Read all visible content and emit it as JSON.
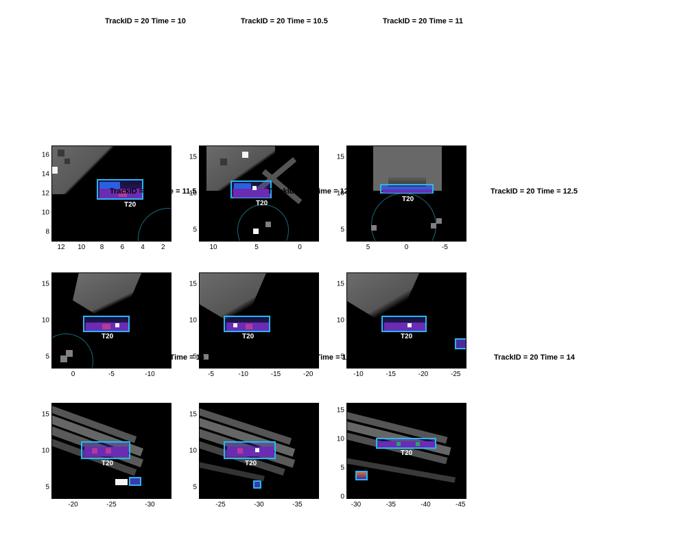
{
  "titles": {
    "r1c1": "TrackID = 20 Time = 10",
    "r1c2": "TrackID = 20 Time = 10.5",
    "r1c3": "TrackID = 20 Time = 11",
    "r2c1": "TrackID = 20 Time = 11.5",
    "r2c2": "TrackID = 20 Time = 12",
    "r2c3": "TrackID = 20 Time = 12.5",
    "r3c1": "TrackID = 20 Time = 13",
    "r3c2": "TrackID = 20 Time = 13.5",
    "r3c3": "TrackID = 20 Time = 14"
  },
  "track_label": "T20",
  "axes": {
    "r1c1": {
      "x": [
        "12",
        "10",
        "8",
        "6",
        "4",
        "2"
      ],
      "y": [
        "8",
        "10",
        "12",
        "14",
        "16"
      ]
    },
    "r1c2": {
      "x": [
        "10",
        "5",
        "0"
      ],
      "y": [
        "5",
        "10",
        "15"
      ]
    },
    "r1c3": {
      "x": [
        "5",
        "0",
        "-5"
      ],
      "y": [
        "5",
        "10",
        "15"
      ]
    },
    "r2c1": {
      "x": [
        "0",
        "-5",
        "-10"
      ],
      "y": [
        "5",
        "10",
        "15"
      ]
    },
    "r2c2": {
      "x": [
        "-5",
        "-10",
        "-15",
        "-20"
      ],
      "y": [
        "5",
        "10",
        "15"
      ]
    },
    "r2c3": {
      "x": [
        "-10",
        "-15",
        "-20",
        "-25"
      ],
      "y": [
        "5",
        "10",
        "15"
      ]
    },
    "r3c1": {
      "x": [
        "-20",
        "-25",
        "-30"
      ],
      "y": [
        "5",
        "10",
        "15"
      ]
    },
    "r3c2": {
      "x": [
        "-25",
        "-30",
        "-35"
      ],
      "y": [
        "5",
        "10",
        "15"
      ]
    },
    "r3c3": {
      "x": [
        "-30",
        "-35",
        "-40",
        "-45"
      ],
      "y": [
        "0",
        "5",
        "10",
        "15"
      ]
    }
  }
}
